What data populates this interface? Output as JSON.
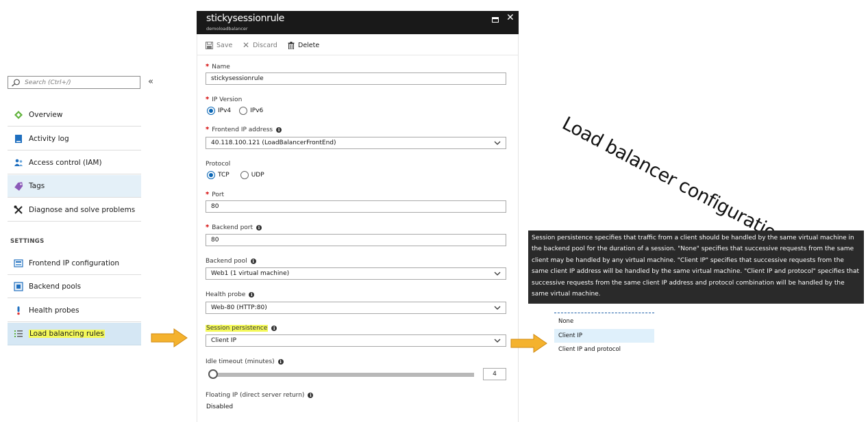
{
  "sidebar": {
    "search_placeholder": "Search (Ctrl+/)",
    "collapse_glyph": "«",
    "items": [
      {
        "label": "Overview",
        "icon": "overview-icon"
      },
      {
        "label": "Activity log",
        "icon": "activity-log-icon"
      },
      {
        "label": "Access control (IAM)",
        "icon": "access-control-icon"
      },
      {
        "label": "Tags",
        "icon": "tag-icon"
      },
      {
        "label": "Diagnose and solve problems",
        "icon": "wrench-icon"
      }
    ],
    "settings_heading": "SETTINGS",
    "settings_items": [
      {
        "label": "Frontend IP configuration",
        "icon": "frontend-ip-icon"
      },
      {
        "label": "Backend pools",
        "icon": "backend-pool-icon"
      },
      {
        "label": "Health probes",
        "icon": "health-probe-icon"
      },
      {
        "label": "Load balancing rules",
        "icon": "rules-icon"
      }
    ]
  },
  "blade": {
    "title": "stickysessionrule",
    "subtitle": "demoloadbalancer",
    "toolbar": {
      "save": "Save",
      "discard": "Discard",
      "delete": "Delete"
    },
    "form": {
      "name_label": "Name",
      "name_value": "stickysessionrule",
      "ip_version_label": "IP Version",
      "ipv4": "IPv4",
      "ipv6": "IPv6",
      "frontend_ip_label": "Frontend IP address",
      "frontend_ip_value": "40.118.100.121 (LoadBalancerFrontEnd)",
      "protocol_label": "Protocol",
      "tcp": "TCP",
      "udp": "UDP",
      "port_label": "Port",
      "port_value": "80",
      "backend_port_label": "Backend port",
      "backend_port_value": "80",
      "backend_pool_label": "Backend pool",
      "backend_pool_value": "Web1 (1 virtual machine)",
      "health_probe_label": "Health probe",
      "health_probe_value": "Web-80 (HTTP:80)",
      "session_persistence_label": "Session persistence",
      "session_persistence_value": "Client IP",
      "idle_timeout_label": "Idle timeout (minutes)",
      "idle_timeout_value": "4",
      "floating_ip_label": "Floating IP (direct server return)",
      "floating_ip_value": "Disabled"
    }
  },
  "annotation": {
    "title": "Load balancer configuration"
  },
  "tooltip": {
    "text": "Session persistence specifies that traffic from a client should be handled by the same virtual machine in the backend pool for the duration of a session. \"None\" specifies that successive requests from the same client may be handled by any virtual machine. \"Client IP\" specifies that successive requests from the same client IP address will be handled by the same virtual machine. \"Client IP and protocol\" specifies that successive requests from the same client IP address and protocol combination will be handled by the same virtual machine."
  },
  "dropdown_options": [
    "None",
    "Client IP",
    "Client IP and protocol"
  ],
  "colors": {
    "accent": "#0a66b5",
    "highlight": "#f3f85a",
    "arrow": "#f4b22e",
    "title_bar": "#191919"
  }
}
